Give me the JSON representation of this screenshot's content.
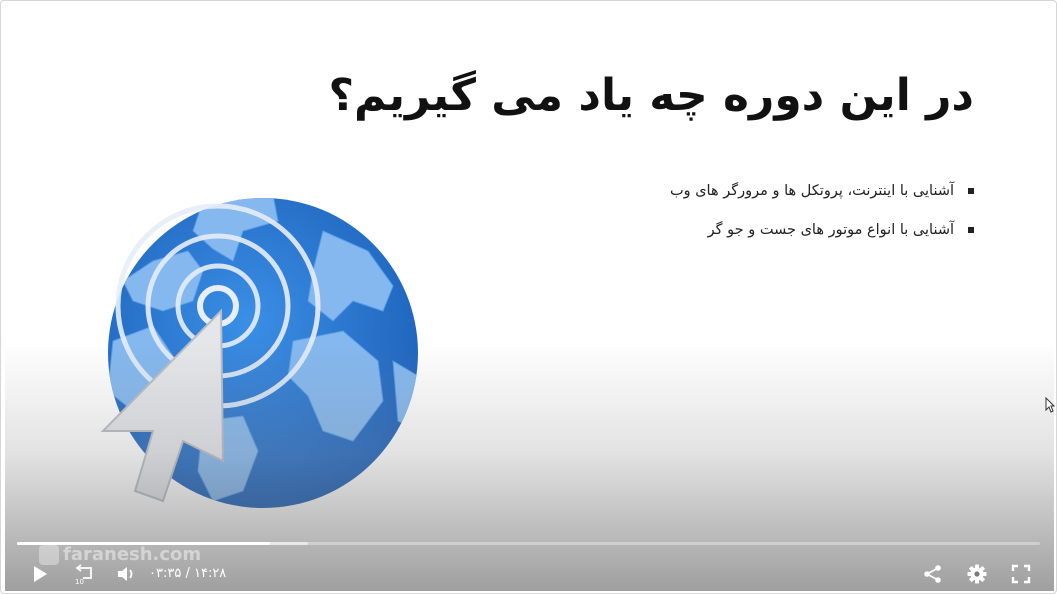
{
  "slide": {
    "title": "در این دوره چه یاد می گیریم؟",
    "bullets": [
      "آشنایی با اینترنت، پروتکل ها و مرورگر های وب",
      "آشنایی با انواع موتور های جست و جو گر"
    ]
  },
  "watermark": {
    "text": "faranesh.com"
  },
  "player": {
    "current_time": "۰۳:۳۵",
    "separator": "/",
    "duration": "۱۴:۲۸",
    "rewind_seconds": "10",
    "played_fraction": 0.247,
    "buffered_fraction": 0.284,
    "icons": {
      "play": "play-icon",
      "rewind": "rewind-10-icon",
      "volume": "volume-icon",
      "share": "share-icon",
      "settings": "gear-icon",
      "fullscreen": "fullscreen-icon"
    }
  },
  "colors": {
    "globe_blue": "#2f7dd4",
    "globe_land": "#7fb3ec",
    "control_white": "#ffffff"
  }
}
